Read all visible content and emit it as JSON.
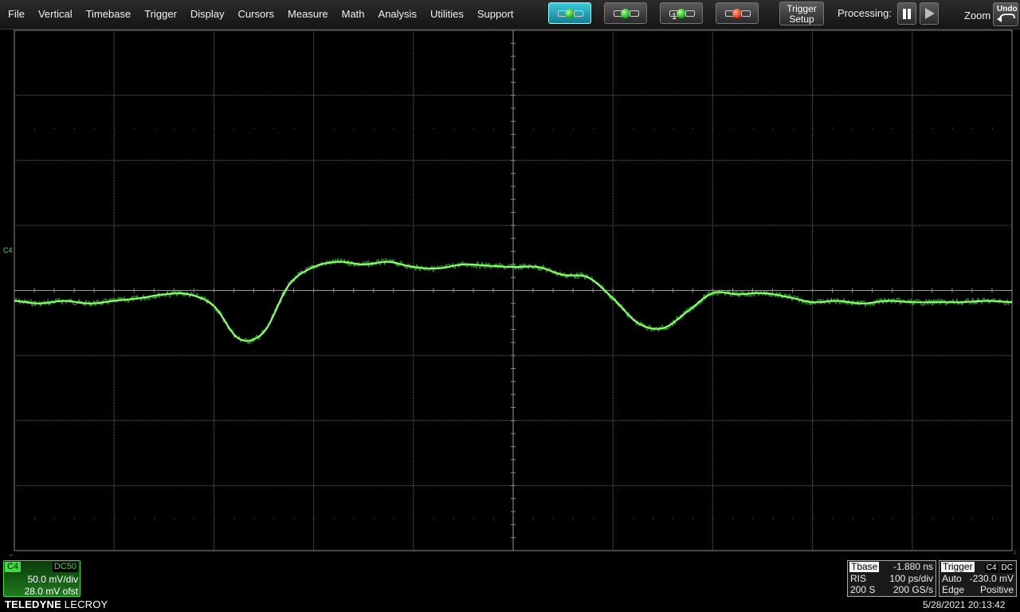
{
  "menu": [
    "File",
    "Vertical",
    "Timebase",
    "Trigger",
    "Display",
    "Cursors",
    "Measure",
    "Math",
    "Analysis",
    "Utilities",
    "Support"
  ],
  "toolbar": {
    "trigger_button_1_tag": "",
    "trigger_button_3_tag": "1",
    "trigger_setup_label": [
      "Trigger",
      "Setup"
    ],
    "processing_label": "Processing:",
    "zoom_label": "Zoom",
    "undo_label": "Undo"
  },
  "channel": {
    "name": "C4",
    "coupling": "DC50",
    "vdiv": "50.0 mV/div",
    "offset": "28.0 mV ofst",
    "color": "#3fdc3f"
  },
  "timebase": {
    "title": "Tbase",
    "delay": "-1.880 ns",
    "mode": "RIS",
    "tdiv": "100 ps/div",
    "samples": "200 S",
    "rate": "200 GS/s"
  },
  "trigger": {
    "title": "Trigger",
    "source": "C4",
    "coupling": "DC",
    "mode": "Auto",
    "level": "-230.0 mV",
    "type": "Edge",
    "slope": "Positive"
  },
  "brand": {
    "bold": "TELEDYNE",
    "normal": "LECROY"
  },
  "datetime": "5/28/2021 20:13:42",
  "chart_data": {
    "type": "line",
    "x_divisions": 10,
    "y_divisions": 8,
    "xlim": [
      -500,
      500
    ],
    "ylim": [
      -200,
      200
    ],
    "xlabel": "",
    "ylabel": "",
    "grid": true,
    "series": [
      {
        "name": "C4",
        "x": [
          -500,
          -475,
          -450,
          -425,
          -400,
          -375,
          -350,
          -325,
          -300,
          -275,
          -250,
          -225,
          -200,
          -175,
          -150,
          -125,
          -100,
          -75,
          -50,
          -25,
          0,
          25,
          50,
          75,
          100,
          125,
          150,
          175,
          200,
          225,
          250,
          275,
          300,
          325,
          350,
          375,
          400,
          425,
          450,
          475,
          500
        ],
        "y": [
          -8,
          -10,
          -8,
          -10,
          -8,
          -6,
          -3,
          -3,
          -12,
          -37,
          -32,
          4,
          18,
          22,
          20,
          22,
          18,
          17,
          20,
          19,
          18,
          18,
          12,
          10,
          -6,
          -25,
          -29,
          -16,
          -2,
          -3,
          -2,
          -5,
          -9,
          -8,
          -10,
          -8,
          -9,
          -9,
          -9,
          -8,
          -9
        ]
      }
    ]
  }
}
